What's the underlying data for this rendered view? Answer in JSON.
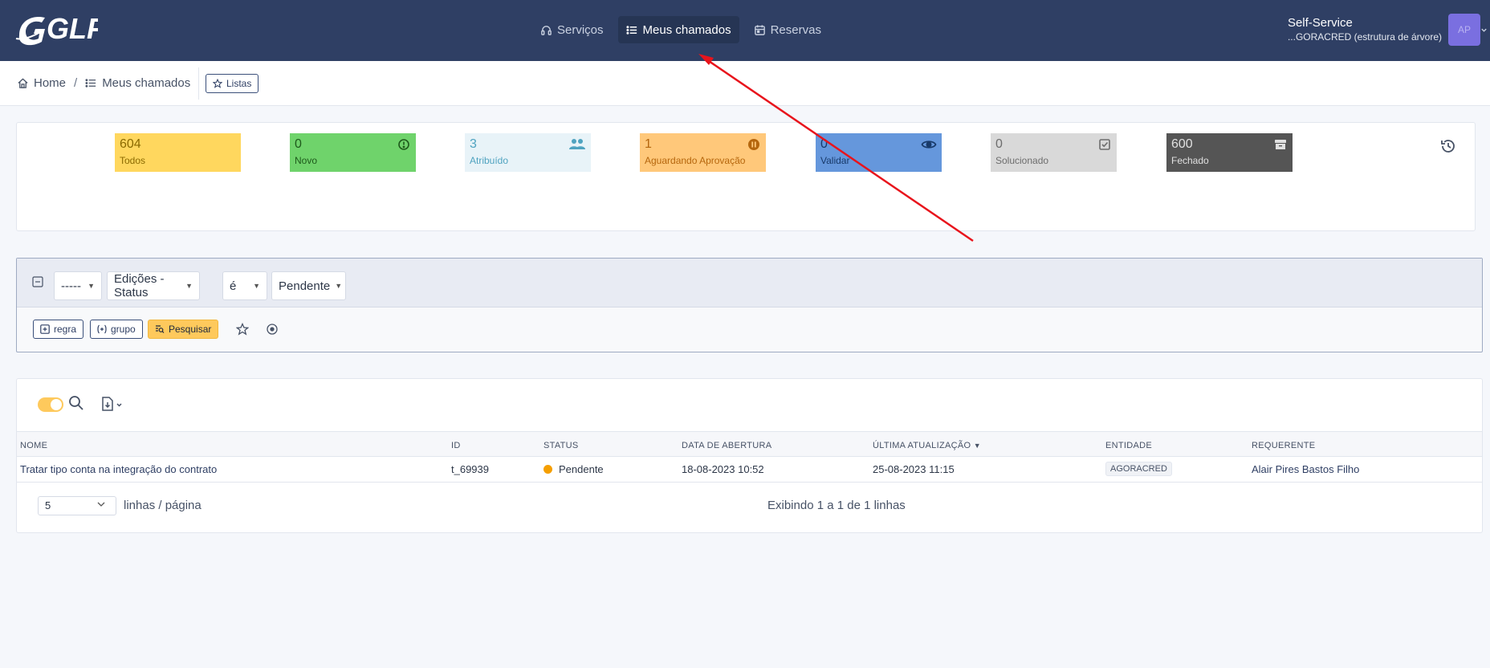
{
  "app": {
    "logo_text": "GLPI"
  },
  "nav": {
    "items": [
      {
        "label": "Serviços",
        "icon": "headset-icon",
        "active": false
      },
      {
        "label": "Meus chamados",
        "icon": "list-icon",
        "active": true
      },
      {
        "label": "Reservas",
        "icon": "calendar-icon",
        "active": false
      }
    ]
  },
  "user": {
    "role": "Self-Service",
    "entity": "...GORACRED (estrutura de árvore)",
    "initials": "AP"
  },
  "breadcrumb": {
    "home": "Home",
    "separator": "/",
    "current": "Meus chamados",
    "lists_button": "Listas"
  },
  "status_tiles": [
    {
      "count": "604",
      "label": "Todos",
      "bg": "#ffd75e",
      "fg": "#8a6a00",
      "icon": ""
    },
    {
      "count": "0",
      "label": "Novo",
      "bg": "#6fd36b",
      "fg": "#1e5a1b",
      "icon": "alert-circle-icon"
    },
    {
      "count": "3",
      "label": "Atribuído",
      "bg": "#e8f3f8",
      "fg": "#4fa3c0",
      "icon": "users-icon"
    },
    {
      "count": "1",
      "label": "Aguardando Aprovação",
      "bg": "#ffc87a",
      "fg": "#b5660d",
      "icon": "pause-circle-icon"
    },
    {
      "count": "0",
      "label": "Validar",
      "bg": "#6597dc",
      "fg": "#183a6a",
      "icon": "eye-icon"
    },
    {
      "count": "0",
      "label": "Solucionado",
      "bg": "#d9d9d9",
      "fg": "#6d6d6d",
      "icon": "checkbox-icon"
    },
    {
      "count": "600",
      "label": "Fechado",
      "bg": "#555555",
      "fg": "#e0e0e0",
      "icon": "archive-icon"
    }
  ],
  "search": {
    "field_1": "-----",
    "field_2": "Edições - Status",
    "operator": "é",
    "value": "Pendente",
    "add_rule": "regra",
    "add_group": "grupo",
    "submit": "Pesquisar"
  },
  "table": {
    "columns": [
      "NOME",
      "ID",
      "STATUS",
      "DATA DE ABERTURA",
      "ÚLTIMA ATUALIZAÇÃO",
      "ENTIDADE",
      "REQUERENTE"
    ],
    "sort_indicator": "▼",
    "rows": [
      {
        "name": "Tratar tipo conta na integração do contrato",
        "id": "t_69939",
        "status": "Pendente",
        "opened": "18-08-2023 10:52",
        "updated": "25-08-2023 11:15",
        "entity": "AGORACRED",
        "requester": "Alair Pires Bastos Filho"
      }
    ]
  },
  "pager": {
    "per_page": "5",
    "per_page_label": "linhas / página",
    "info": "Exibindo 1 a 1 de 1 linhas"
  },
  "colors": {
    "topbar": "#2f3f64",
    "accent": "#fec95c",
    "annotation_arrow": "#e8141c"
  }
}
